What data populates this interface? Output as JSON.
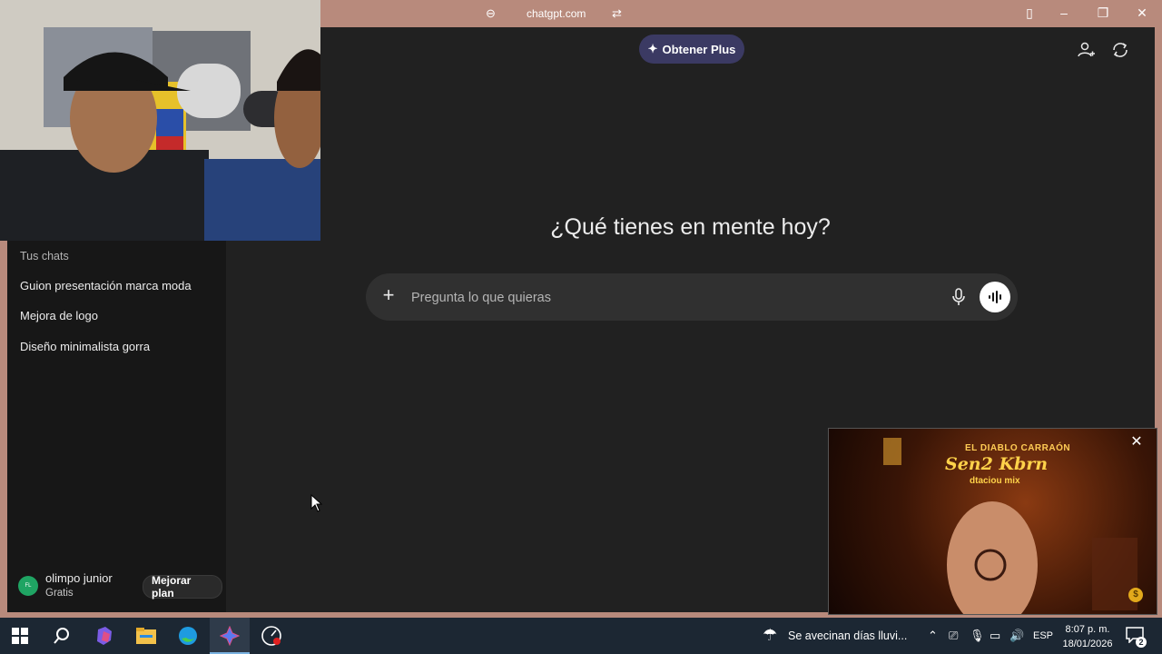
{
  "titlebar": {
    "url": "chatgpt.com"
  },
  "header": {
    "get_plus_label": "Obtener Plus"
  },
  "main": {
    "headline": "¿Qué tienes en mente hoy?",
    "composer_placeholder": "Pregunta lo que quieras"
  },
  "sidebar": {
    "section_title": "Tus chats",
    "chats": [
      "Guion presentación marca moda",
      "Mejora de logo",
      "Diseño minimalista gorra"
    ],
    "user": {
      "initials": "FL",
      "name": "olimpo junior",
      "plan": "Gratis",
      "upgrade_label": "Mejorar plan"
    }
  },
  "video_popup": {
    "line1": "EL DIABLO CARRAÓN",
    "line2": "Sen2 Kbrn",
    "line3": "dtaciou mix"
  },
  "taskbar": {
    "weather": "Se avecinan días lluvi...",
    "language": "ESP",
    "time": "8:07 p. m.",
    "date": "18/01/2026",
    "notifications": "2"
  },
  "colors": {
    "plus_button_bg": "#3b3a63",
    "avatar_bg": "#1fa463",
    "frame": "#b88a7c"
  }
}
